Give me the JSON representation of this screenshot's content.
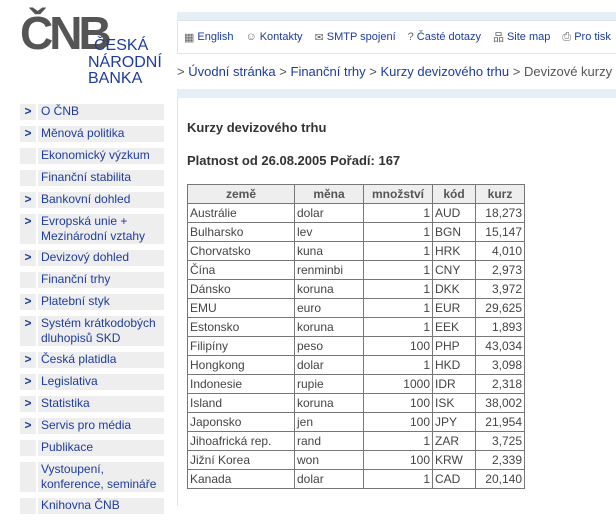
{
  "logo": {
    "mark": "ČNB",
    "line1": "ČESKÁ",
    "line2": "NÁRODNÍ",
    "line3": "BANKA"
  },
  "toolbar": [
    {
      "icon": "flag-icon",
      "glyph": "▦",
      "label": "English"
    },
    {
      "icon": "contacts-icon",
      "glyph": "☺",
      "label": "Kontakty"
    },
    {
      "icon": "mail-icon",
      "glyph": "✉",
      "label": "SMTP spojení"
    },
    {
      "icon": "faq-icon",
      "glyph": "?",
      "label": "Časté dotazy"
    },
    {
      "icon": "sitemap-icon",
      "glyph": "品",
      "label": "Site map"
    },
    {
      "icon": "print-icon",
      "glyph": "⎙",
      "label": "Pro tisk"
    }
  ],
  "breadcrumb": {
    "items": [
      "Úvodní stránka",
      "Finanční trhy",
      "Kurzy devizového trhu"
    ],
    "current": "Devizové kurzy",
    "sep": ">"
  },
  "menu": [
    {
      "label": "O ČNB",
      "arrow": ">"
    },
    {
      "label": "Měnová politika",
      "arrow": ">"
    },
    {
      "label": "Ekonomický výzkum",
      "arrow": ""
    },
    {
      "label": "Finanční stabilita",
      "arrow": ""
    },
    {
      "label": "Bankovní dohled",
      "arrow": ">"
    },
    {
      "label": "Evropská unie + Mezinárodní vztahy",
      "arrow": ">"
    },
    {
      "label": "Devizový dohled",
      "arrow": ">"
    },
    {
      "label": "Finanční trhy",
      "arrow": ""
    },
    {
      "label": "Platební styk",
      "arrow": ">"
    },
    {
      "label": "Systém krátkodobých dluhopisů SKD",
      "arrow": ">"
    },
    {
      "label": "Česká platidla",
      "arrow": ">"
    },
    {
      "label": "Legislativa",
      "arrow": ">"
    },
    {
      "label": "Statistika",
      "arrow": ">"
    },
    {
      "label": "Servis pro média",
      "arrow": ">"
    },
    {
      "label": "Publikace",
      "arrow": ""
    },
    {
      "label": "Vystoupení, konference, semináře",
      "arrow": ""
    },
    {
      "label": "Knihovna ČNB",
      "arrow": ""
    }
  ],
  "main": {
    "title": "Kurzy devizového trhu",
    "subtitle": "Platnost od 26.08.2005 Pořadí: 167",
    "columns": [
      "země",
      "měna",
      "množství",
      "kód",
      "kurz"
    ],
    "rows": [
      [
        "Austrálie",
        "dolar",
        "1",
        "AUD",
        "18,273"
      ],
      [
        "Bulharsko",
        "lev",
        "1",
        "BGN",
        "15,147"
      ],
      [
        "Chorvatsko",
        "kuna",
        "1",
        "HRK",
        "4,010"
      ],
      [
        "Čína",
        "renminbi",
        "1",
        "CNY",
        "2,973"
      ],
      [
        "Dánsko",
        "koruna",
        "1",
        "DKK",
        "3,972"
      ],
      [
        "EMU",
        "euro",
        "1",
        "EUR",
        "29,625"
      ],
      [
        "Estonsko",
        "koruna",
        "1",
        "EEK",
        "1,893"
      ],
      [
        "Filipíny",
        "peso",
        "100",
        "PHP",
        "43,034"
      ],
      [
        "Hongkong",
        "dolar",
        "1",
        "HKD",
        "3,098"
      ],
      [
        "Indonesie",
        "rupie",
        "1000",
        "IDR",
        "2,318"
      ],
      [
        "Island",
        "koruna",
        "100",
        "ISK",
        "38,002"
      ],
      [
        "Japonsko",
        "jen",
        "100",
        "JPY",
        "21,954"
      ],
      [
        "Jihoafrická rep.",
        "rand",
        "1",
        "ZAR",
        "3,725"
      ],
      [
        "Jižní Korea",
        "won",
        "100",
        "KRW",
        "2,339"
      ],
      [
        "Kanada",
        "dolar",
        "1",
        "CAD",
        "20,140"
      ]
    ]
  },
  "colors": {
    "link": "#1e3c9c",
    "menu_bg": "#eeeeee",
    "bar": "#e6eef6"
  }
}
